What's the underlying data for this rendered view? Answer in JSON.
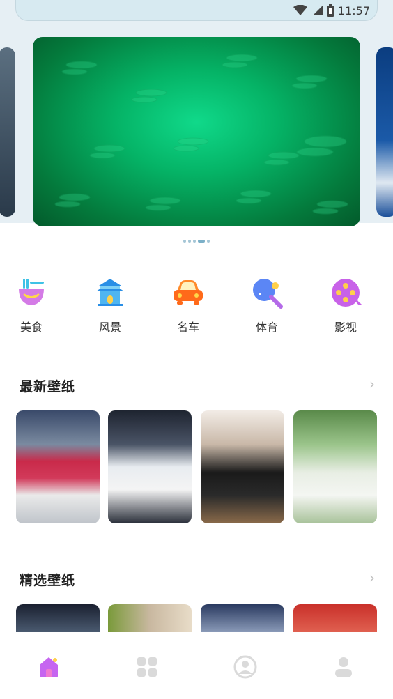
{
  "status_bar": {
    "time": "11:57",
    "icons": [
      "wifi-icon",
      "signal-icon",
      "battery-icon"
    ]
  },
  "banner": {
    "slide_count": 5,
    "active_index": 3
  },
  "categories": [
    {
      "label": "美食",
      "icon": "food-bowl-icon"
    },
    {
      "label": "风景",
      "icon": "pavilion-icon"
    },
    {
      "label": "名车",
      "icon": "car-icon"
    },
    {
      "label": "体育",
      "icon": "ping-pong-icon"
    },
    {
      "label": "影视",
      "icon": "film-reel-icon"
    }
  ],
  "sections": {
    "latest": {
      "title": "最新壁纸",
      "more": "›"
    },
    "featured": {
      "title": "精选壁纸",
      "more": "›"
    }
  },
  "tabbar": {
    "items": [
      "home-icon",
      "grid-icon",
      "profile-circle-icon",
      "user-icon"
    ],
    "active_index": 0
  },
  "colors": {
    "accent": "#c665f0",
    "inactive_tab": "#dadada"
  }
}
